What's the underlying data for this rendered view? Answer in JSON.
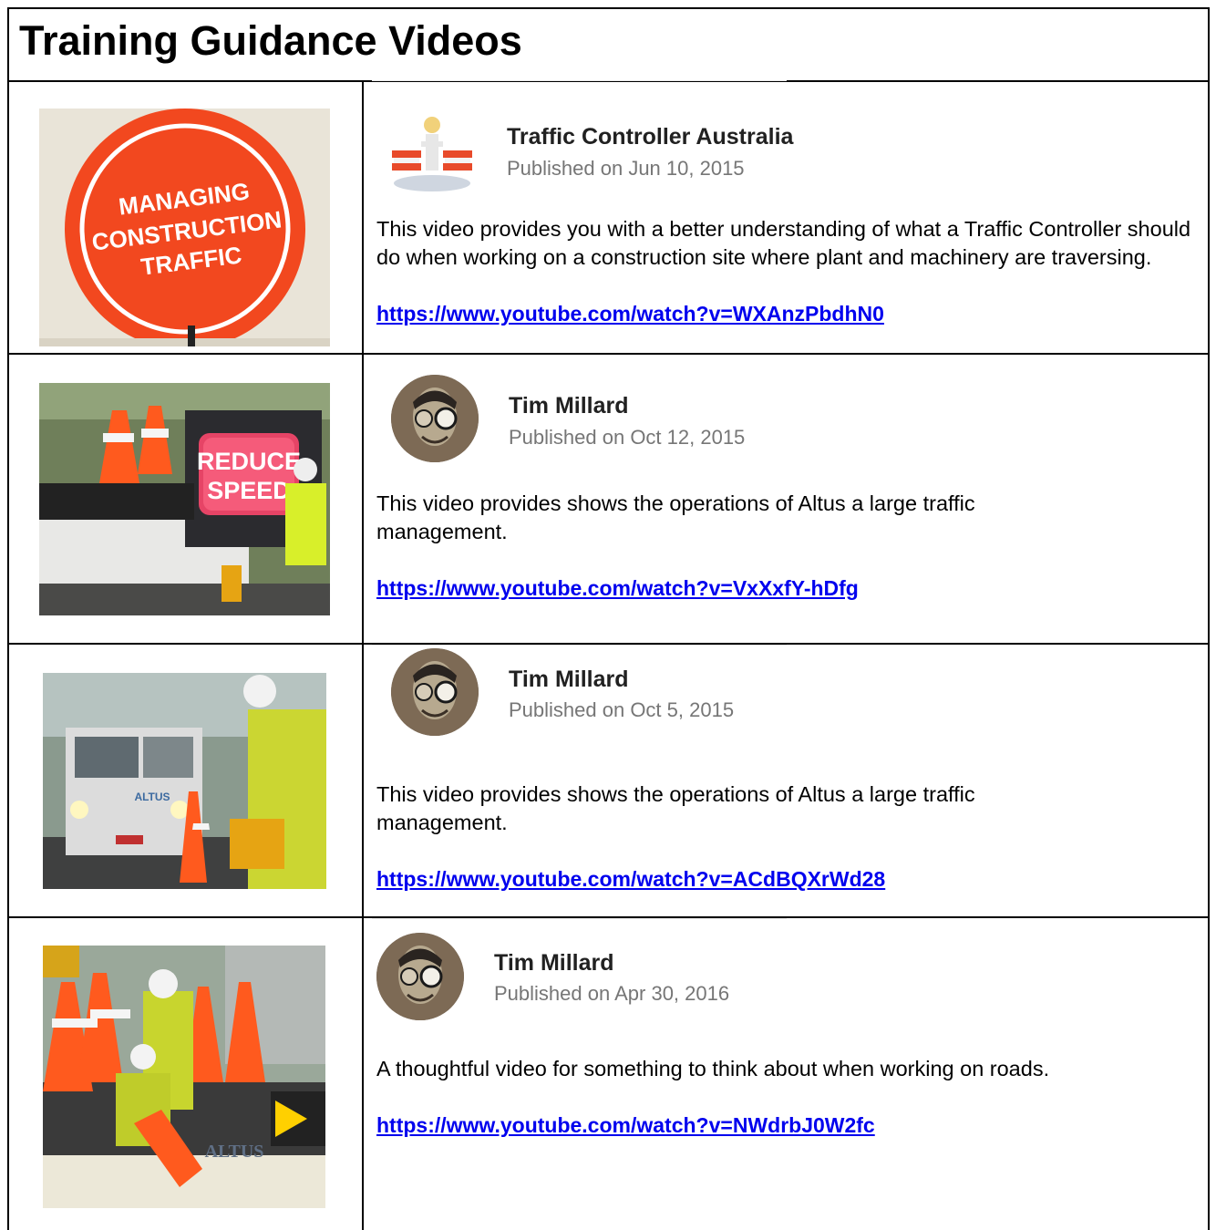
{
  "page": {
    "title": "Training Guidance Videos"
  },
  "videos": [
    {
      "thumbnail_text": [
        "MANAGING",
        "CONSTRUCTION",
        "TRAFFIC"
      ],
      "channel": "Traffic Controller Australia",
      "published": "Published on Jun 10, 2015",
      "description": "This video provides you with a better understanding of what a Traffic Controller should do when working on a construction site where plant and machinery are traversing.",
      "url": "https://www.youtube.com/watch?v=WXAnzPbdhN0"
    },
    {
      "thumbnail_text": [
        "REDUCE",
        "SPEED"
      ],
      "channel": "Tim Millard",
      "published": "Published on Oct 12, 2015",
      "description": "This video provides shows the operations of Altus a large traffic management.",
      "url": "https://www.youtube.com/watch?v=VxXxfY-hDfg"
    },
    {
      "thumbnail_text": [
        "ALTUS"
      ],
      "channel": "Tim Millard",
      "published": "Published on Oct 5, 2015",
      "description": "This video provides shows the operations of Altus a large traffic management.",
      "url": "https://www.youtube.com/watch?v=ACdBQXrWd28"
    },
    {
      "thumbnail_text": [
        "ALTUS"
      ],
      "channel": "Tim Millard",
      "published": "Published on Apr 30, 2016",
      "description": "A thoughtful video for something to think about when working on roads.",
      "url": "https://www.youtube.com/watch?v=NWdrbJ0W2fc"
    }
  ],
  "colors": {
    "link": "#0000ee",
    "sign_orange": "#f2481f",
    "channel_name": "#212121",
    "published": "#767676"
  }
}
